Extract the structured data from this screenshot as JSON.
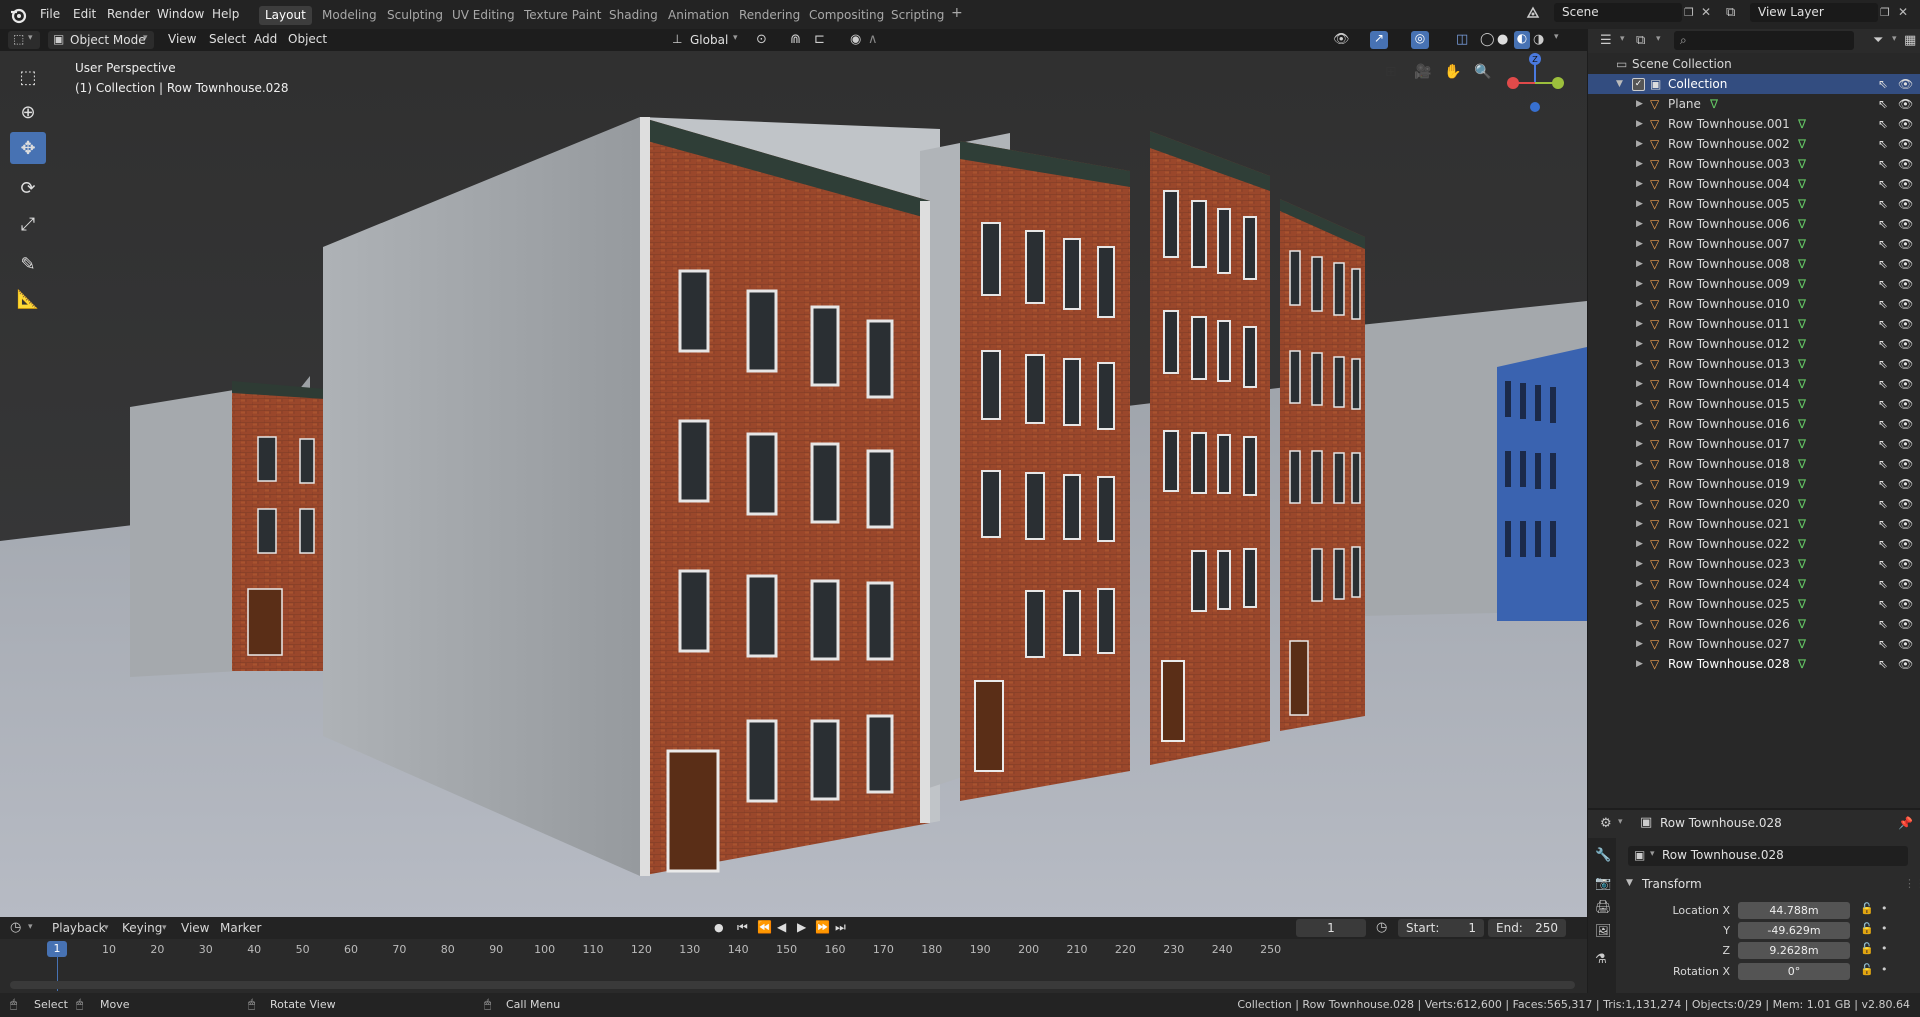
{
  "topbar": {
    "menus": [
      "File",
      "Edit",
      "Render",
      "Window",
      "Help"
    ],
    "workspaces": [
      "Layout",
      "Modeling",
      "Sculpting",
      "UV Editing",
      "Texture Paint",
      "Shading",
      "Animation",
      "Rendering",
      "Compositing",
      "Scripting"
    ],
    "add_tab": "+",
    "scene": "Scene",
    "view_layer": "View Layer"
  },
  "viewport_header": {
    "mode": "Object Mode",
    "menus": [
      "View",
      "Select",
      "Add",
      "Object"
    ],
    "orientation": "Global"
  },
  "viewport": {
    "perspective": "User Perspective",
    "object_info": "(1) Collection | Row Townhouse.028",
    "gizmo": {
      "z": "Z"
    }
  },
  "outliner": {
    "search_placeholder": "",
    "scene_collection": "Scene Collection",
    "collection": "Collection",
    "items": [
      "Plane",
      "Row Townhouse.001",
      "Row Townhouse.002",
      "Row Townhouse.003",
      "Row Townhouse.004",
      "Row Townhouse.005",
      "Row Townhouse.006",
      "Row Townhouse.007",
      "Row Townhouse.008",
      "Row Townhouse.009",
      "Row Townhouse.010",
      "Row Townhouse.011",
      "Row Townhouse.012",
      "Row Townhouse.013",
      "Row Townhouse.014",
      "Row Townhouse.015",
      "Row Townhouse.016",
      "Row Townhouse.017",
      "Row Townhouse.018",
      "Row Townhouse.019",
      "Row Townhouse.020",
      "Row Townhouse.021",
      "Row Townhouse.022",
      "Row Townhouse.023",
      "Row Townhouse.024",
      "Row Townhouse.025",
      "Row Townhouse.026",
      "Row Townhouse.027",
      "Row Townhouse.028"
    ]
  },
  "properties": {
    "header_object": "Row Townhouse.028",
    "name_field": "Row Townhouse.028",
    "panel": "Transform",
    "location_x_label": "Location X",
    "location_x": "44.788m",
    "y_label": "Y",
    "location_y": "-49.629m",
    "z_label": "Z",
    "location_z": "9.2628m",
    "rotation_x_label": "Rotation X",
    "rotation_x": "0°"
  },
  "timeline": {
    "menus": [
      "Playback",
      "Keying",
      "View",
      "Marker"
    ],
    "current_frame": "1",
    "start_label": "Start:",
    "start": "1",
    "end_label": "End:",
    "end": "250",
    "ticks": [
      "1",
      "10",
      "20",
      "30",
      "40",
      "50",
      "60",
      "70",
      "80",
      "90",
      "100",
      "110",
      "120",
      "130",
      "140",
      "150",
      "160",
      "170",
      "180",
      "190",
      "200",
      "210",
      "220",
      "230",
      "240",
      "250"
    ]
  },
  "status": {
    "select": "Select",
    "move": "Move",
    "rotate_view": "Rotate View",
    "call_menu": "Call Menu",
    "stats": "Collection | Row Townhouse.028 | Verts:612,600 | Faces:565,317 | Tris:1,131,274 | Objects:0/29 | Mem: 1.01 GB | v2.80.64"
  },
  "colors": {
    "accent": "#4772b3",
    "brick": "#9c4a2c",
    "concrete": "#a9aeb3",
    "blue_building": "#3a63b0",
    "mesh_icon": "#f0a050",
    "vert_icon": "#63c463"
  }
}
